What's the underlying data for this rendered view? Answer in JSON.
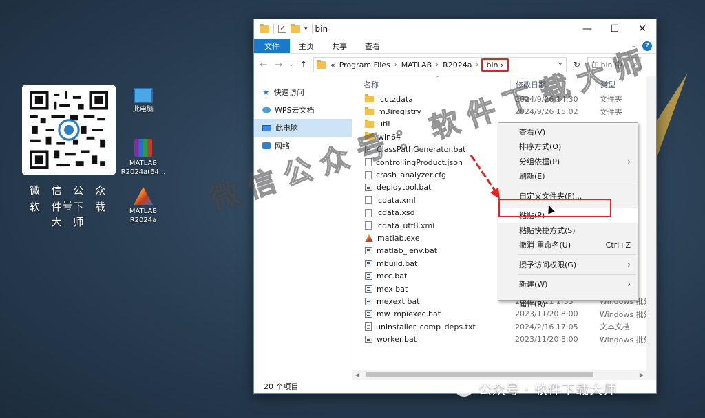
{
  "desktop": {
    "qr_caption_1": "微 信 公 众 号",
    "qr_caption_2": "软 件 下 载 大 师",
    "icons": [
      {
        "label": "此电脑"
      },
      {
        "label": "MATLAB R2024a(64..."
      },
      {
        "label": "MATLAB R2024a"
      }
    ]
  },
  "window": {
    "title": "bin",
    "ribbon_tabs": [
      "文件",
      "主页",
      "共享",
      "查看"
    ],
    "address": [
      "Program Files",
      "MATLAB",
      "R2024a",
      "bin"
    ],
    "address_overflow": "«",
    "search_placeholder": "在 bin 中...",
    "nav_items": [
      {
        "label": "快速访问",
        "icon": "star-icon"
      },
      {
        "label": "WPS云文档",
        "icon": "cloud-icon"
      },
      {
        "label": "此电脑",
        "icon": "computer-icon",
        "selected": true
      },
      {
        "label": "网络",
        "icon": "network-icon"
      }
    ],
    "columns": {
      "name": "名称",
      "date": "修改日期",
      "type": "类型"
    },
    "files": [
      {
        "name": "icutzdata",
        "date": "2024/9/26 14:30",
        "type": "文件夹",
        "kind": "folder"
      },
      {
        "name": "m3iregistry",
        "date": "2024/9/26 15:02",
        "type": "文件夹",
        "kind": "folder"
      },
      {
        "name": "util",
        "date": "",
        "type": "",
        "kind": "folder"
      },
      {
        "name": "win64",
        "date": "",
        "type": "",
        "kind": "folder"
      },
      {
        "name": "ClassPathGenerator.bat",
        "date": "",
        "type": "批处",
        "kind": "bat"
      },
      {
        "name": "controllingProduct.json",
        "date": "",
        "type": "",
        "kind": "file"
      },
      {
        "name": "crash_analyzer.cfg",
        "date": "",
        "type": "",
        "kind": "file"
      },
      {
        "name": "deploytool.bat",
        "date": "",
        "type": "批处",
        "kind": "bat"
      },
      {
        "name": "lcdata.xml",
        "date": "",
        "type": "",
        "kind": "file"
      },
      {
        "name": "lcdata.xsd",
        "date": "",
        "type": "",
        "kind": "file"
      },
      {
        "name": "lcdata_utf8.xml",
        "date": "",
        "type": "",
        "kind": "file"
      },
      {
        "name": "matlab.exe",
        "date": "",
        "type": "",
        "kind": "matlab"
      },
      {
        "name": "matlab_jenv.bat",
        "date": "",
        "type": "批处",
        "kind": "bat"
      },
      {
        "name": "mbuild.bat",
        "date": "",
        "type": "批处",
        "kind": "bat"
      },
      {
        "name": "mcc.bat",
        "date": "",
        "type": "批处",
        "kind": "bat"
      },
      {
        "name": "mex.bat",
        "date": "",
        "type": "批处",
        "kind": "bat"
      },
      {
        "name": "mexext.bat",
        "date": "2023/6/21 1:33",
        "type": "Windows 批处",
        "kind": "bat"
      },
      {
        "name": "mw_mpiexec.bat",
        "date": "2023/11/20 8:00",
        "type": "Windows 批处",
        "kind": "bat"
      },
      {
        "name": "uninstaller_comp_deps.txt",
        "date": "2024/2/16 17:05",
        "type": "文本文档",
        "kind": "txt"
      },
      {
        "name": "worker.bat",
        "date": "2023/11/20 8:00",
        "type": "Windows 批处",
        "kind": "bat"
      }
    ],
    "status": "20 个项目"
  },
  "context_menu": {
    "items": [
      {
        "label": "查看(V)",
        "arrow": ""
      },
      {
        "label": "排序方式(O)",
        "arrow": ""
      },
      {
        "label": "分组依据(P)",
        "arrow": "›"
      },
      {
        "label": "刷新(E)",
        "arrow": ""
      },
      {
        "sep": true
      },
      {
        "label": "自定义文件夹(F)...",
        "arrow": ""
      },
      {
        "sep": true
      },
      {
        "label": "粘贴(P)",
        "arrow": "",
        "highlight": true
      },
      {
        "label": "粘贴快捷方式(S)",
        "arrow": ""
      },
      {
        "label": "撤消 重命名(U)",
        "shortcut": "Ctrl+Z"
      },
      {
        "sep": true
      },
      {
        "label": "授予访问权限(G)",
        "arrow": "›"
      },
      {
        "sep": true
      },
      {
        "label": "新建(W)",
        "arrow": "›"
      },
      {
        "sep": true
      },
      {
        "label": "属性(R)",
        "arrow": ""
      }
    ]
  },
  "watermark": "微信公众号：软件下载大师",
  "wechat_tag": "公众号 · 软件下载大师",
  "colors": {
    "accent": "#1979ca",
    "highlight_box": "#e02424",
    "desktop": "#2c4157"
  }
}
